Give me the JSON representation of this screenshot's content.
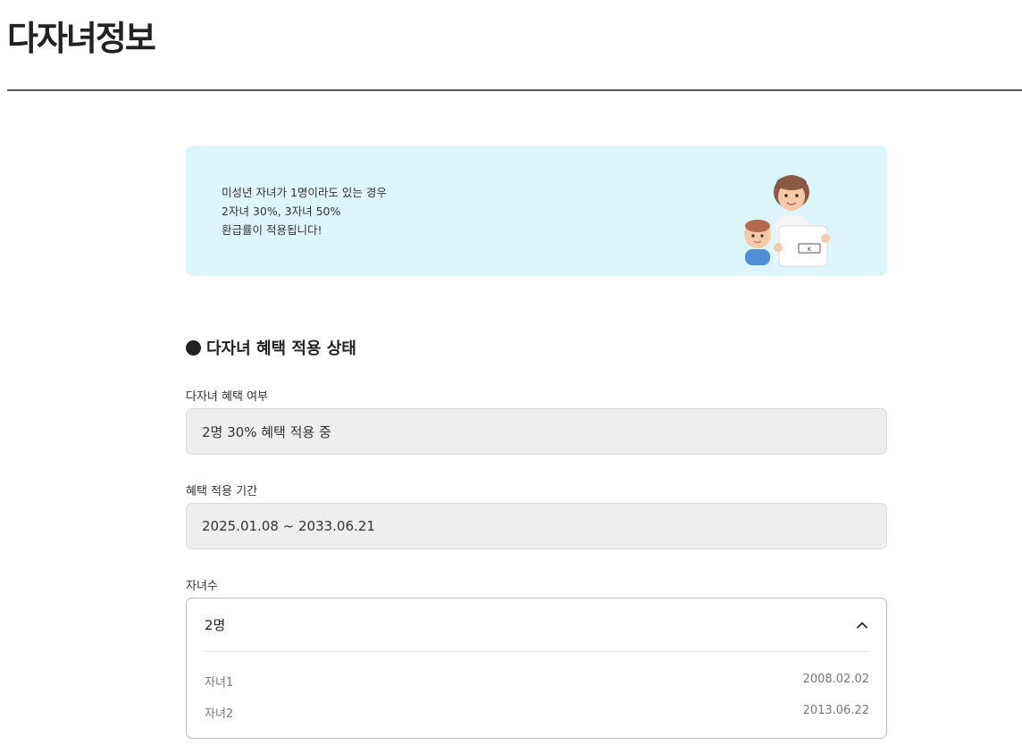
{
  "header": {
    "title": "다자녀정보"
  },
  "banner": {
    "line1": "미성년 자녀가 1명이라도 있는 경우",
    "line2": "2자녀 30%, 3자녀 50%",
    "line3": "환급률이 적용됩니다!",
    "illustration": "mother-and-child-illustration",
    "bg_color": "#ddf6fb"
  },
  "section": {
    "heading": "다자녀 혜택 적용 상태"
  },
  "fields": {
    "benefit_label": "다자녀 혜택 여부",
    "benefit_value": "2명 30% 혜택 적용 중",
    "period_label": "혜택 적용 기간",
    "period_value": "2025.01.08 ~ 2033.06.21",
    "children_label": "자녀수"
  },
  "children": {
    "count": "2명",
    "toggle_icon": "chevron-up-icon",
    "items": [
      {
        "name": "자녀1",
        "birth": "2008.02.02"
      },
      {
        "name": "자녀2",
        "birth": "2013.06.22"
      }
    ]
  }
}
